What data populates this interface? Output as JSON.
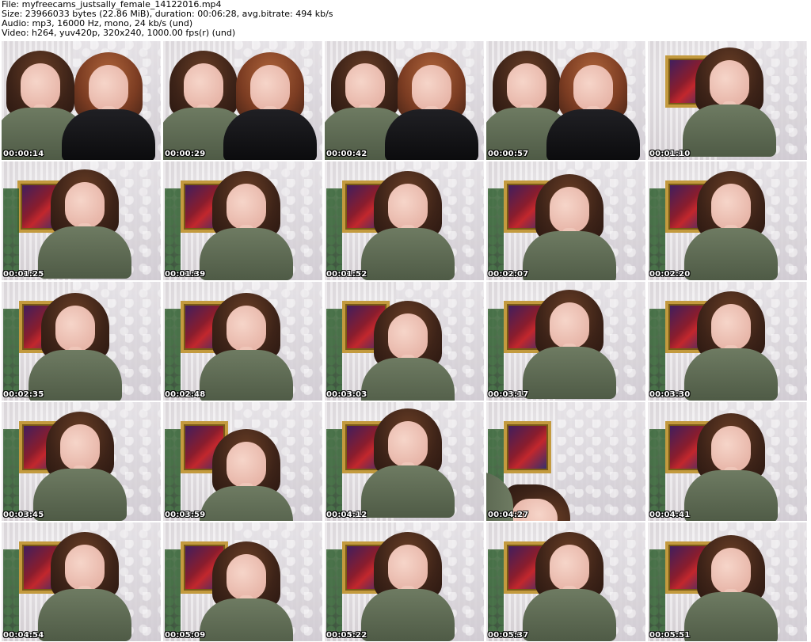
{
  "header": {
    "file_line": "File: myfreecams_justsally_female_14122016.mp4",
    "size_line": "Size: 23966033 bytes (22.86 MiB), duration: 00:06:28, avg.bitrate: 494 kb/s",
    "audio_line": "Audio: mp3, 16000 Hz, mono, 24 kb/s (und)",
    "video_line": "Video: h264, yuv420p, 320x240, 1000.00 fps(r) (und)"
  },
  "thumbnails": [
    {
      "timestamp": "00:00:14"
    },
    {
      "timestamp": "00:00:29"
    },
    {
      "timestamp": "00:00:42"
    },
    {
      "timestamp": "00:00:57"
    },
    {
      "timestamp": "00:01:10"
    },
    {
      "timestamp": "00:01:25"
    },
    {
      "timestamp": "00:01:39"
    },
    {
      "timestamp": "00:01:52"
    },
    {
      "timestamp": "00:02:07"
    },
    {
      "timestamp": "00:02:20"
    },
    {
      "timestamp": "00:02:35"
    },
    {
      "timestamp": "00:02:48"
    },
    {
      "timestamp": "00:03:03"
    },
    {
      "timestamp": "00:03:17"
    },
    {
      "timestamp": "00:03:30"
    },
    {
      "timestamp": "00:03:45"
    },
    {
      "timestamp": "00:03:59"
    },
    {
      "timestamp": "00:04:12"
    },
    {
      "timestamp": "00:04:27"
    },
    {
      "timestamp": "00:04:41"
    },
    {
      "timestamp": "00:04:54"
    },
    {
      "timestamp": "00:05:09"
    },
    {
      "timestamp": "00:05:22"
    },
    {
      "timestamp": "00:05:37"
    },
    {
      "timestamp": "00:05:51"
    }
  ]
}
